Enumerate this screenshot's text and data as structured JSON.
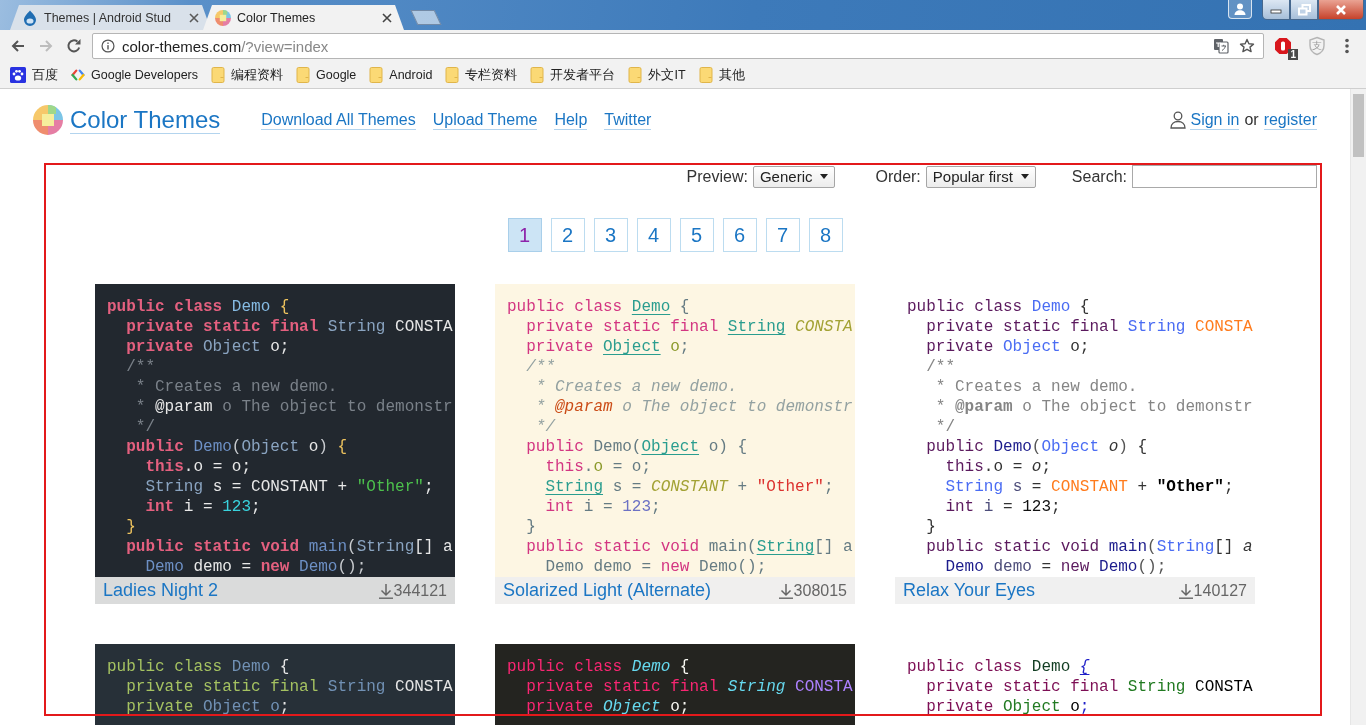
{
  "browser": {
    "tabs": [
      {
        "title": "Themes | Android Stud",
        "selected": false
      },
      {
        "title": "Color Themes",
        "selected": true
      }
    ],
    "nav_buttons": [
      {
        "kind": "back",
        "disabled": false
      },
      {
        "kind": "forward",
        "disabled": true
      },
      {
        "kind": "reload",
        "disabled": false
      }
    ],
    "address": {
      "host": "color-themes.com",
      "path": "/?view=index"
    },
    "extensions": [
      {
        "kind": "blocker",
        "badge": "1"
      },
      {
        "kind": "shield",
        "glyph": "支"
      }
    ],
    "bookmarks": [
      {
        "kind": "site",
        "label": "百度"
      },
      {
        "kind": "site",
        "label": "Google Developers"
      },
      {
        "kind": "folder",
        "label": "编程资料"
      },
      {
        "kind": "folder",
        "label": "Google"
      },
      {
        "kind": "folder",
        "label": "Android"
      },
      {
        "kind": "folder",
        "label": "专栏资料"
      },
      {
        "kind": "folder",
        "label": "开发者平台"
      },
      {
        "kind": "folder",
        "label": "外文IT"
      },
      {
        "kind": "folder",
        "label": "其他"
      }
    ]
  },
  "site": {
    "logo": "Color Themes",
    "nav": [
      "Download All Themes",
      "Upload Theme",
      "Help",
      "Twitter"
    ],
    "sign_in": "Sign in",
    "or": "or",
    "register": "register"
  },
  "filters": {
    "preview_label": "Preview:",
    "preview_value": "Generic",
    "order_label": "Order:",
    "order_value": "Popular first",
    "search_label": "Search:"
  },
  "pages": [
    {
      "label": "1",
      "selected": true
    },
    {
      "label": "2",
      "selected": false
    },
    {
      "label": "3",
      "selected": false
    },
    {
      "label": "4",
      "selected": false
    },
    {
      "label": "5",
      "selected": false
    },
    {
      "label": "6",
      "selected": false
    },
    {
      "label": "7",
      "selected": false
    },
    {
      "label": "8",
      "selected": false
    }
  ],
  "themes": [
    {
      "name": "Ladies Night 2",
      "downloads": "344121",
      "code": [
        [
          {
            "kind": "keyword",
            "text": "public class "
          },
          {
            "kind": "classname",
            "text": "Demo"
          },
          {
            "kind": "brace",
            "text": " {"
          }
        ],
        [
          {
            "kind": "keyword",
            "text": "  private static final "
          },
          {
            "kind": "type",
            "text": "String"
          },
          {
            "kind": "constant",
            "text": " CONSTA"
          }
        ],
        [
          {
            "kind": "keyword",
            "text": "  private "
          },
          {
            "kind": "type",
            "text": "Object"
          },
          {
            "kind": "field",
            "text": " o"
          },
          {
            "kind": "plain",
            "text": ";"
          }
        ],
        [
          {
            "kind": "comment",
            "text": "  /**"
          }
        ],
        [
          {
            "kind": "comment",
            "text": "   * Creates a new demo."
          }
        ],
        [
          {
            "kind": "comment",
            "text": "   * "
          },
          {
            "kind": "doctag",
            "text": "@param"
          },
          {
            "kind": "comment",
            "text": " o The object to demonstr"
          }
        ],
        [
          {
            "kind": "comment",
            "text": "   */"
          }
        ],
        [
          {
            "kind": "keyword",
            "text": "  public "
          },
          {
            "kind": "classref",
            "text": "Demo"
          },
          {
            "kind": "punct",
            "text": "("
          },
          {
            "kind": "type",
            "text": "Object"
          },
          {
            "kind": "param",
            "text": " o"
          },
          {
            "kind": "punct",
            "text": ")"
          },
          {
            "kind": "brace",
            "text": " {"
          }
        ],
        [
          {
            "kind": "keyword",
            "text": "    this"
          },
          {
            "kind": "plain",
            "text": "."
          },
          {
            "kind": "field",
            "text": "o"
          },
          {
            "kind": "plain",
            "text": " = "
          },
          {
            "kind": "param",
            "text": "o"
          },
          {
            "kind": "plain",
            "text": ";"
          }
        ],
        [
          {
            "kind": "type",
            "text": "    String"
          },
          {
            "kind": "local",
            "text": " s"
          },
          {
            "kind": "plain",
            "text": " = "
          },
          {
            "kind": "constant",
            "text": "CONSTANT"
          },
          {
            "kind": "plain",
            "text": " + "
          },
          {
            "kind": "string",
            "text": "\"Other\""
          },
          {
            "kind": "plain",
            "text": ";"
          }
        ],
        [
          {
            "kind": "keyword",
            "text": "    int"
          },
          {
            "kind": "local",
            "text": " i"
          },
          {
            "kind": "plain",
            "text": " = "
          },
          {
            "kind": "number",
            "text": "123"
          },
          {
            "kind": "plain",
            "text": ";"
          }
        ],
        [
          {
            "kind": "brace",
            "text": "  }"
          }
        ],
        [
          {
            "kind": "keyword",
            "text": "  public static void "
          },
          {
            "kind": "method",
            "text": "main"
          },
          {
            "kind": "punct",
            "text": "("
          },
          {
            "kind": "type",
            "text": "String"
          },
          {
            "kind": "plain",
            "text": "[] "
          },
          {
            "kind": "param",
            "text": "a"
          }
        ],
        [
          {
            "kind": "classref",
            "text": "    Demo"
          },
          {
            "kind": "local",
            "text": " demo"
          },
          {
            "kind": "plain",
            "text": " = "
          },
          {
            "kind": "keyword",
            "text": "new"
          },
          {
            "kind": "classref",
            "text": " Demo"
          },
          {
            "kind": "punct",
            "text": "();"
          }
        ]
      ]
    },
    {
      "name": "Solarized Light (Alternate)",
      "downloads": "308015",
      "code": [
        [
          {
            "kind": "keyword",
            "text": "public class "
          },
          {
            "kind": "classname",
            "text": "Demo"
          },
          {
            "kind": "brace",
            "text": " {"
          }
        ],
        [
          {
            "kind": "keyword",
            "text": "  private static final "
          },
          {
            "kind": "type",
            "text": "String"
          },
          {
            "kind": "constant",
            "text": " CONSTA"
          }
        ],
        [
          {
            "kind": "keyword",
            "text": "  private "
          },
          {
            "kind": "type",
            "text": "Object"
          },
          {
            "kind": "field",
            "text": " o"
          },
          {
            "kind": "plain",
            "text": ";"
          }
        ],
        [
          {
            "kind": "comment",
            "text": "  /**"
          }
        ],
        [
          {
            "kind": "comment",
            "text": "   * Creates a new demo."
          }
        ],
        [
          {
            "kind": "comment",
            "text": "   * "
          },
          {
            "kind": "doctag",
            "text": "@param"
          },
          {
            "kind": "comment",
            "text": " o The object to demonstr"
          }
        ],
        [
          {
            "kind": "comment",
            "text": "   */"
          }
        ],
        [
          {
            "kind": "keyword",
            "text": "  public "
          },
          {
            "kind": "classref",
            "text": "Demo"
          },
          {
            "kind": "punct",
            "text": "("
          },
          {
            "kind": "type",
            "text": "Object"
          },
          {
            "kind": "param",
            "text": " o"
          },
          {
            "kind": "punct",
            "text": ")"
          },
          {
            "kind": "brace",
            "text": " {"
          }
        ],
        [
          {
            "kind": "keyword",
            "text": "    this"
          },
          {
            "kind": "plain",
            "text": "."
          },
          {
            "kind": "field",
            "text": "o"
          },
          {
            "kind": "plain",
            "text": " = "
          },
          {
            "kind": "param",
            "text": "o"
          },
          {
            "kind": "plain",
            "text": ";"
          }
        ],
        [
          {
            "kind": "type",
            "text": "    String"
          },
          {
            "kind": "local",
            "text": " s"
          },
          {
            "kind": "plain",
            "text": " = "
          },
          {
            "kind": "constant",
            "text": "CONSTANT"
          },
          {
            "kind": "plain",
            "text": " + "
          },
          {
            "kind": "string",
            "text": "\"Other\""
          },
          {
            "kind": "plain",
            "text": ";"
          }
        ],
        [
          {
            "kind": "keyword",
            "text": "    int"
          },
          {
            "kind": "local",
            "text": " i"
          },
          {
            "kind": "plain",
            "text": " = "
          },
          {
            "kind": "number",
            "text": "123"
          },
          {
            "kind": "plain",
            "text": ";"
          }
        ],
        [
          {
            "kind": "brace",
            "text": "  }"
          }
        ],
        [
          {
            "kind": "keyword",
            "text": "  public static void "
          },
          {
            "kind": "method",
            "text": "main"
          },
          {
            "kind": "punct",
            "text": "("
          },
          {
            "kind": "type",
            "text": "String"
          },
          {
            "kind": "plain",
            "text": "[] "
          },
          {
            "kind": "param",
            "text": "a"
          }
        ],
        [
          {
            "kind": "classref",
            "text": "    Demo"
          },
          {
            "kind": "local",
            "text": " demo"
          },
          {
            "kind": "plain",
            "text": " = "
          },
          {
            "kind": "keyword",
            "text": "new"
          },
          {
            "kind": "classref",
            "text": " Demo"
          },
          {
            "kind": "punct",
            "text": "();"
          }
        ]
      ]
    },
    {
      "name": "Relax Your Eyes",
      "downloads": "140127",
      "code": [
        [
          {
            "kind": "keyword",
            "text": "public class "
          },
          {
            "kind": "classname",
            "text": "Demo"
          },
          {
            "kind": "brace",
            "text": " {"
          }
        ],
        [
          {
            "kind": "keyword",
            "text": "  private static final "
          },
          {
            "kind": "type",
            "text": "String"
          },
          {
            "kind": "constant",
            "text": " CONSTA"
          }
        ],
        [
          {
            "kind": "keyword",
            "text": "  private "
          },
          {
            "kind": "type",
            "text": "Object"
          },
          {
            "kind": "field",
            "text": " o"
          },
          {
            "kind": "plain",
            "text": ";"
          }
        ],
        [
          {
            "kind": "comment",
            "text": "  /**"
          }
        ],
        [
          {
            "kind": "comment",
            "text": "   * Creates a new demo."
          }
        ],
        [
          {
            "kind": "comment",
            "text": "   * "
          },
          {
            "kind": "doctag",
            "text": "@param"
          },
          {
            "kind": "comment",
            "text": " o The object to demonstr"
          }
        ],
        [
          {
            "kind": "comment",
            "text": "   */"
          }
        ],
        [
          {
            "kind": "keyword",
            "text": "  public "
          },
          {
            "kind": "classref",
            "text": "Demo"
          },
          {
            "kind": "punct",
            "text": "("
          },
          {
            "kind": "type",
            "text": "Object"
          },
          {
            "kind": "param",
            "text": " o"
          },
          {
            "kind": "punct",
            "text": ")"
          },
          {
            "kind": "brace",
            "text": " {"
          }
        ],
        [
          {
            "kind": "keyword",
            "text": "    this"
          },
          {
            "kind": "plain",
            "text": "."
          },
          {
            "kind": "field",
            "text": "o"
          },
          {
            "kind": "plain",
            "text": " = "
          },
          {
            "kind": "param",
            "text": "o"
          },
          {
            "kind": "plain",
            "text": ";"
          }
        ],
        [
          {
            "kind": "type",
            "text": "    String"
          },
          {
            "kind": "local",
            "text": " s"
          },
          {
            "kind": "plain",
            "text": " = "
          },
          {
            "kind": "constant",
            "text": "CONSTANT"
          },
          {
            "kind": "plain",
            "text": " + "
          },
          {
            "kind": "string",
            "text": "\"Other\""
          },
          {
            "kind": "plain",
            "text": ";"
          }
        ],
        [
          {
            "kind": "keyword",
            "text": "    int"
          },
          {
            "kind": "local",
            "text": " i"
          },
          {
            "kind": "plain",
            "text": " = "
          },
          {
            "kind": "number",
            "text": "123"
          },
          {
            "kind": "plain",
            "text": ";"
          }
        ],
        [
          {
            "kind": "brace",
            "text": "  }"
          }
        ],
        [
          {
            "kind": "keyword",
            "text": "  public static void "
          },
          {
            "kind": "method",
            "text": "main"
          },
          {
            "kind": "punct",
            "text": "("
          },
          {
            "kind": "type",
            "text": "String"
          },
          {
            "kind": "plain",
            "text": "[] "
          },
          {
            "kind": "param",
            "text": "a"
          }
        ],
        [
          {
            "kind": "classref",
            "text": "    Demo"
          },
          {
            "kind": "local",
            "text": " demo"
          },
          {
            "kind": "plain",
            "text": " = "
          },
          {
            "kind": "keyword",
            "text": "new"
          },
          {
            "kind": "classref",
            "text": " Demo"
          },
          {
            "kind": "punct",
            "text": "();"
          }
        ]
      ]
    },
    {
      "code": [
        [
          {
            "kind": "keyword",
            "text": "public class "
          },
          {
            "kind": "classname",
            "text": "Demo"
          },
          {
            "kind": "brace",
            "text": " {"
          }
        ],
        [
          {
            "kind": "keyword",
            "text": "  private static final "
          },
          {
            "kind": "type",
            "text": "String"
          },
          {
            "kind": "constant",
            "text": " CONSTA"
          }
        ],
        [
          {
            "kind": "keyword",
            "text": "  private "
          },
          {
            "kind": "type",
            "text": "Object"
          },
          {
            "kind": "field",
            "text": " o"
          },
          {
            "kind": "plain",
            "text": ";"
          }
        ]
      ]
    },
    {
      "code": [
        [
          {
            "kind": "keyword",
            "text": "public class "
          },
          {
            "kind": "classname",
            "text": "Demo"
          },
          {
            "kind": "brace",
            "text": " {"
          }
        ],
        [
          {
            "kind": "keyword",
            "text": "  private static final "
          },
          {
            "kind": "type",
            "text": "String"
          },
          {
            "kind": "constant",
            "text": " CONSTA"
          }
        ],
        [
          {
            "kind": "keyword",
            "text": "  private "
          },
          {
            "kind": "type",
            "text": "Object"
          },
          {
            "kind": "field",
            "text": " o"
          },
          {
            "kind": "plain",
            "text": ";"
          }
        ]
      ]
    },
    {
      "code": [
        [
          {
            "kind": "keyword",
            "text": "public class "
          },
          {
            "kind": "classname",
            "text": "Demo"
          },
          {
            "kind": "brace",
            "text": " {"
          }
        ],
        [
          {
            "kind": "keyword",
            "text": "  private static final "
          },
          {
            "kind": "type",
            "text": "String"
          },
          {
            "kind": "constant",
            "text": " CONSTA"
          }
        ],
        [
          {
            "kind": "keyword",
            "text": "  private "
          },
          {
            "kind": "type",
            "text": "Object"
          },
          {
            "kind": "field",
            "text": " o"
          },
          {
            "kind": "plain",
            "text": ";"
          }
        ]
      ]
    }
  ]
}
